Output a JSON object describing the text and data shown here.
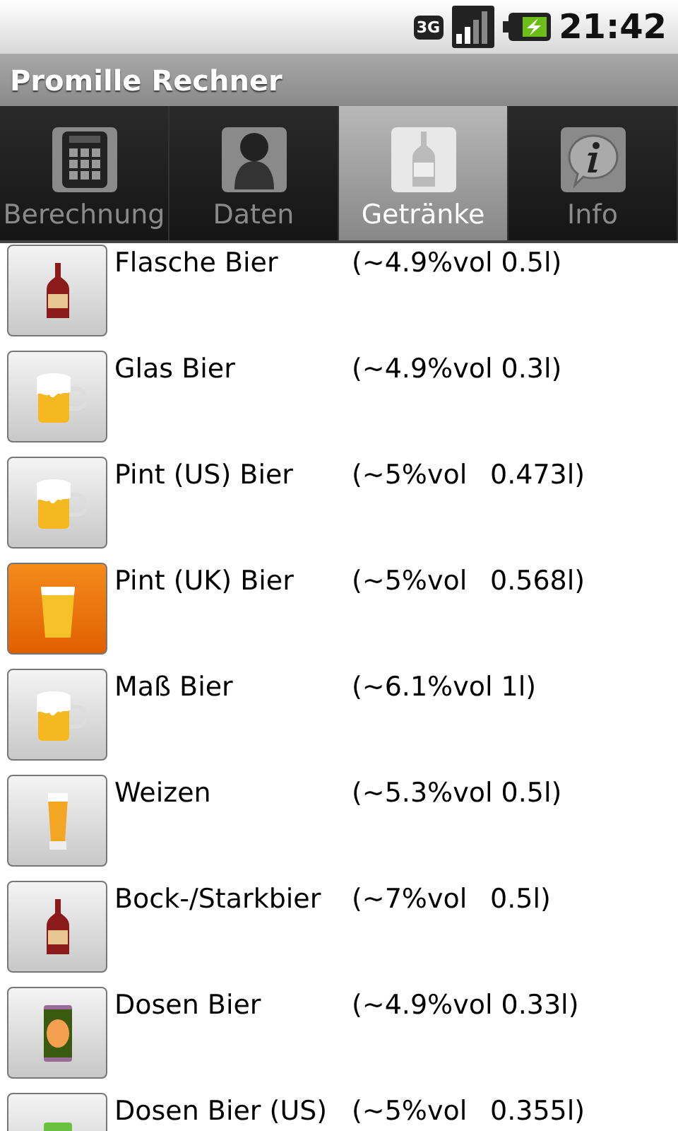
{
  "status_bar": {
    "network": "3G",
    "time": "21:42"
  },
  "title": "Promille Rechner",
  "tabs": [
    {
      "label": "Berechnung",
      "kind": "calculator",
      "selected": false
    },
    {
      "label": "Daten",
      "kind": "person",
      "selected": false
    },
    {
      "label": "Getränke",
      "kind": "bottle",
      "selected": true
    },
    {
      "label": "Info",
      "kind": "info",
      "selected": false
    }
  ],
  "drinks": [
    {
      "name": "Flasche Bier",
      "abv": "(~4.9%vol",
      "volume": "0.5l)",
      "kind": "bottle",
      "selected": false
    },
    {
      "name": "Glas Bier",
      "abv": "(~4.9%vol",
      "volume": "0.3l)",
      "kind": "mug",
      "selected": false
    },
    {
      "name": "Pint (US) Bier",
      "abv": "(~5%vol",
      "volume": "0.473l)",
      "kind": "mug",
      "selected": false
    },
    {
      "name": "Pint (UK) Bier",
      "abv": "(~5%vol",
      "volume": "0.568l)",
      "kind": "pint",
      "selected": true
    },
    {
      "name": "Maß Bier",
      "abv": "(~6.1%vol",
      "volume": "1l)",
      "kind": "mug",
      "selected": false
    },
    {
      "name": "Weizen",
      "abv": "(~5.3%vol",
      "volume": "0.5l)",
      "kind": "weizen",
      "selected": false
    },
    {
      "name": "Bock-/Starkbier",
      "abv": "(~7%vol",
      "volume": "0.5l)",
      "kind": "bottle",
      "selected": false
    },
    {
      "name": "Dosen Bier",
      "abv": "(~4.9%vol",
      "volume": "0.33l)",
      "kind": "can",
      "selected": false
    },
    {
      "name": "Dosen Bier (US)",
      "abv": "(~5%vol",
      "volume": "0.355l)",
      "kind": "greencan",
      "selected": false
    }
  ]
}
